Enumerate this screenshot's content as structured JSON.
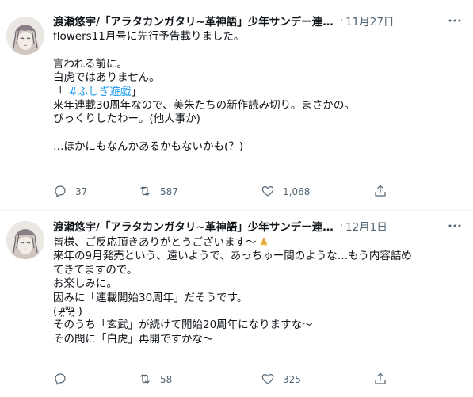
{
  "tweets": [
    {
      "author": "渡瀬悠宇/「アラタカンガタリ~革神語」少年サンデー連…",
      "separator": "·",
      "date": "11月27日",
      "lines": [
        "flowers11月号に先行予告載りました。",
        "",
        "言われる前に。",
        "白虎ではありません。",
        "「",
        "来年連載30周年なので、美朱たちの新作読み切り。まさかの。",
        "びっくりしたわー。(他人事か)",
        "",
        "…ほかにもなんかあるかもないかも(？)"
      ],
      "hashtag": "#ふしぎ遊戯",
      "hashtag_close": "」",
      "replies": "37",
      "retweets": "587",
      "likes": "1,068"
    },
    {
      "author": "渡瀬悠宇/「アラタカンガタリ~革神語」少年サンデー連…",
      "separator": "·",
      "date": "12月1日",
      "lines": [
        "皆様、ご反応頂きありがとうございます〜",
        "来年の9月発売という、遠いようで、あっちゅー間のような…もう内容詰め",
        "てきてますので。",
        "お楽しみに。",
        "因みに「連載開始30周年」だそうです。",
        "( ᵒ̴̶̷̤ᐜᵒ̴̶̷̤ )",
        "そのうち「玄武」が続けて開始20周年になりますな〜",
        "その間に「白虎」再開ですかな〜"
      ],
      "emoji": "folded-hands",
      "replies": "",
      "retweets": "58",
      "likes": "325"
    }
  ],
  "colors": {
    "text": "#0f1419",
    "muted": "#536471",
    "hashtag": "#1d9bf0",
    "divider": "#eff3f4"
  },
  "icons": [
    "avatar",
    "more-icon",
    "reply-icon",
    "retweet-icon",
    "like-icon",
    "share-icon",
    "folded-hands-emoji"
  ]
}
